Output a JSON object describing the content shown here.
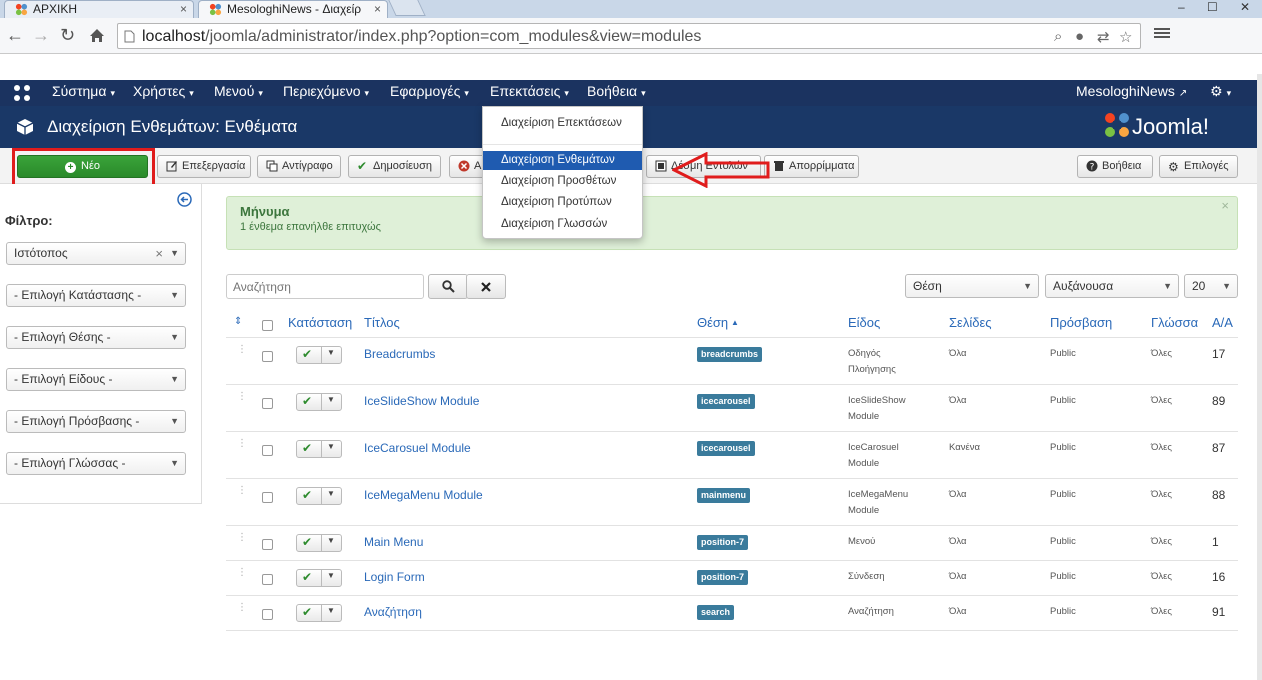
{
  "browser": {
    "tabs": [
      {
        "label": "ΑΡΧΙΚΗ",
        "close": "×"
      },
      {
        "label": "MesologhiNews - Διαχείρ",
        "close": "×"
      }
    ],
    "url_host": "localhost",
    "url_path": "/joomla/administrator/index.php?option=com_modules&view=modules",
    "window_buttons": [
      "–",
      "☐",
      "✕"
    ]
  },
  "navbar": {
    "items": [
      "Σύστημα",
      "Χρήστες",
      "Μενού",
      "Περιεχόμενο",
      "Εφαρμογές",
      "Επεκτάσεις",
      "Βοήθεια"
    ],
    "site_name": "MesologhiNews",
    "caret": "▾"
  },
  "header": {
    "title": "Διαχείριση Ενθεμάτων: Ενθέματα",
    "logo_text": "Joomla!"
  },
  "toolbar": {
    "new": "Νέο",
    "edit": "Επεξεργασία",
    "copy": "Αντίγραφο",
    "publish": "Δημοσίευση",
    "unpublish": "Α",
    "batch": "Δέσμη Εντολών",
    "trash": "Απορρίμματα",
    "help": "Βοήθεια",
    "options": "Επιλογές"
  },
  "extensions_menu": {
    "items": [
      "Διαχείριση Επεκτάσεων",
      "Διαχείριση Ενθεμάτων",
      "Διαχείριση Προσθέτων",
      "Διαχείριση Προτύπων",
      "Διαχείριση Γλωσσών"
    ],
    "active_index": 1
  },
  "sidebar": {
    "filter_label": "Φίλτρο:",
    "site_select": "Ιστότοπος",
    "filters": [
      "- Επιλογή Κατάστασης -",
      "- Επιλογή Θέσης -",
      "- Επιλογή Είδους -",
      "- Επιλογή Πρόσβασης -",
      "- Επιλογή Γλώσσας -"
    ]
  },
  "message": {
    "heading": "Μήνυμα",
    "text": "1 ένθεμα επανήλθε επιτυχώς",
    "close": "×"
  },
  "search": {
    "placeholder": "Αναζήτηση"
  },
  "list_controls": {
    "order_by": "Θέση",
    "direction": "Αυξάνουσα",
    "limit": "20"
  },
  "table": {
    "headers": {
      "status": "Κατάσταση",
      "title": "Τίτλος",
      "position": "Θέση",
      "type": "Είδος",
      "pages": "Σελίδες",
      "access": "Πρόσβαση",
      "language": "Γλώσσα",
      "id": "Α/Α"
    },
    "rows": [
      {
        "title": "Breadcrumbs",
        "position": "breadcrumbs",
        "type_line1": "Οδηγός",
        "type_line2": "Πλοήγησης",
        "pages": "Όλα",
        "access": "Public",
        "language": "Όλες",
        "id": "17"
      },
      {
        "title": "IceSlideShow Module",
        "position": "icecarousel",
        "type_line1": "IceSlideShow",
        "type_line2": "Module",
        "pages": "Όλα",
        "access": "Public",
        "language": "Όλες",
        "id": "89"
      },
      {
        "title": "IceCarosuel Module",
        "position": "icecarousel",
        "type_line1": "IceCarosuel",
        "type_line2": "Module",
        "pages": "Κανένα",
        "access": "Public",
        "language": "Όλες",
        "id": "87"
      },
      {
        "title": "IceMegaMenu Module",
        "position": "mainmenu",
        "type_line1": "IceMegaMenu",
        "type_line2": "Module",
        "pages": "Όλα",
        "access": "Public",
        "language": "Όλες",
        "id": "88"
      },
      {
        "title": "Main Menu",
        "position": "position-7",
        "type_line1": "Μενού",
        "type_line2": "",
        "pages": "Όλα",
        "access": "Public",
        "language": "Όλες",
        "id": "1"
      },
      {
        "title": "Login Form",
        "position": "position-7",
        "type_line1": "Σύνδεση",
        "type_line2": "",
        "pages": "Όλα",
        "access": "Public",
        "language": "Όλες",
        "id": "16"
      },
      {
        "title": "Αναζήτηση",
        "position": "search",
        "type_line1": "Αναζήτηση",
        "type_line2": "",
        "pages": "Όλα",
        "access": "Public",
        "language": "Όλες",
        "id": "91"
      }
    ]
  },
  "colors": {
    "navbar": "#1b3360",
    "header": "#1a3867",
    "success_button": "#2a8a2a",
    "link": "#2a69b8",
    "annotation_red": "#e01c1c"
  }
}
